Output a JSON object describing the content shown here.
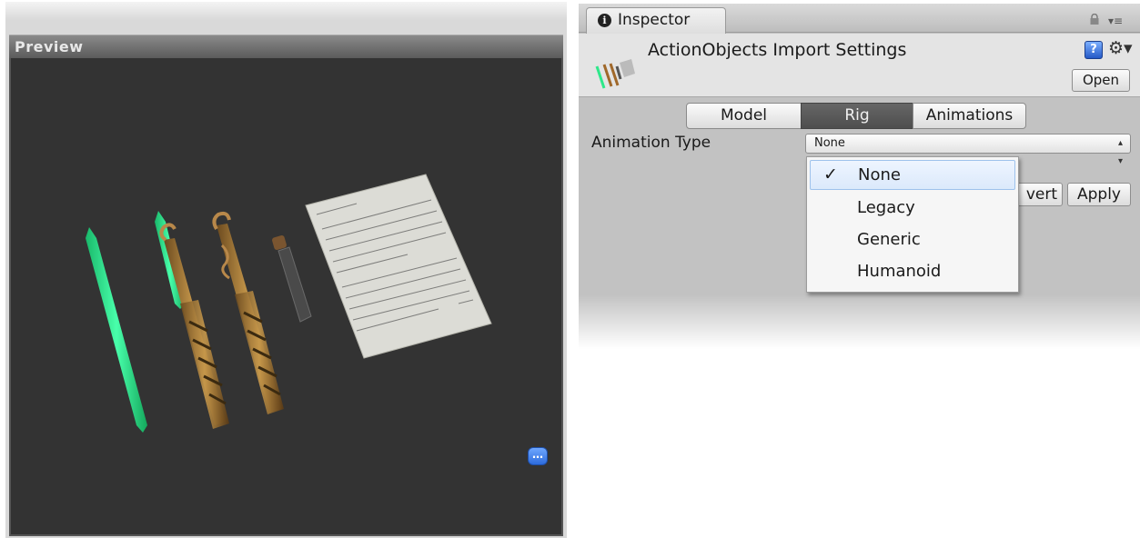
{
  "preview": {
    "title": "Preview"
  },
  "inspector": {
    "tab_label": "Inspector",
    "asset_title": "ActionObjects Import Settings",
    "open_label": "Open",
    "tabs": [
      {
        "label": "Model",
        "active": false
      },
      {
        "label": "Rig",
        "active": true
      },
      {
        "label": "Animations",
        "active": false
      }
    ],
    "animation_type": {
      "label": "Animation Type",
      "value": "None",
      "options": [
        "None",
        "Legacy",
        "Generic",
        "Humanoid"
      ],
      "selected": "None"
    },
    "revert_label": "vert",
    "apply_label": "Apply"
  },
  "colors": {
    "viewport_bg": "#333333",
    "selected_tab": "#555555",
    "inspector_bg": "#c2c2c2",
    "glow_green": "#2ee88a"
  }
}
